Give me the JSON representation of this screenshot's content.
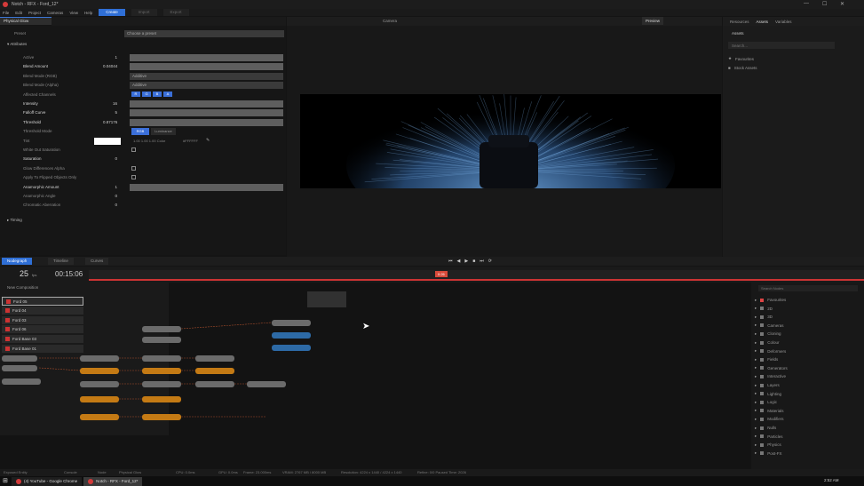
{
  "titlebar": {
    "title": "Notch - RFX - Ford_12*",
    "min": "—",
    "max": "☐",
    "close": "✕"
  },
  "menu": {
    "items": [
      "File",
      "Edit",
      "Project",
      "Cameras",
      "View",
      "Help"
    ],
    "tabs": [
      "Create",
      "Import",
      "Export"
    ]
  },
  "properties": {
    "tab": "Physical Glow",
    "preset_label": "Preset",
    "preset_value": "Choose a preset",
    "section": "Attributes",
    "rows": [
      {
        "label": "Active",
        "value": "1",
        "kind": "bar",
        "bold": false
      },
      {
        "label": "Blend Amount",
        "value": "0.04044",
        "kind": "bar",
        "bold": true
      },
      {
        "label": "Blend Mode (RGB)",
        "value": "Additive",
        "kind": "select",
        "bold": false
      },
      {
        "label": "Blend Mode (Alpha)",
        "value": "Additive",
        "kind": "select",
        "bold": false
      },
      {
        "label": "Affected Channels",
        "value": "",
        "kind": "channels",
        "bold": false
      },
      {
        "label": "Intensity",
        "value": "16",
        "kind": "bar",
        "bold": true
      },
      {
        "label": "Falloff Curve",
        "value": "5",
        "kind": "bar",
        "bold": true
      },
      {
        "label": "Threshold",
        "value": "0.87176",
        "kind": "bar",
        "bold": true
      },
      {
        "label": "Threshold Mode",
        "value": "",
        "kind": "mode",
        "bold": false
      },
      {
        "label": "Tint",
        "value": "",
        "kind": "tint",
        "bold": false
      },
      {
        "label": "White Out Saturation",
        "value": "",
        "kind": "check",
        "bold": false
      },
      {
        "label": "Saturation",
        "value": "0",
        "kind": "none",
        "bold": true
      },
      {
        "label": "Glow Differences Alpha",
        "value": "",
        "kind": "check",
        "bold": false
      },
      {
        "label": "Apply To Flipped Objects Only",
        "value": "",
        "kind": "check",
        "bold": false
      },
      {
        "label": "Anamorphic Amount",
        "value": "1",
        "kind": "bar",
        "bold": true
      },
      {
        "label": "Anamorphic Angle",
        "value": "0",
        "kind": "none",
        "bold": false
      },
      {
        "label": "Chromatic Aberration",
        "value": "0",
        "kind": "none",
        "bold": false
      }
    ],
    "channels": [
      "R",
      "G",
      "B",
      "A"
    ],
    "modes": [
      "RGB",
      "Luminance"
    ],
    "tint": {
      "rgb": "1.00 1.00 1.00 Color",
      "hex": "#FFFFFF"
    },
    "timing_section": "Timing"
  },
  "viewport": {
    "preview_btn": "Preview",
    "view_label": "Camera"
  },
  "right_panel": {
    "tabs": [
      "Resources",
      "Assets",
      "Variables"
    ],
    "title": "Assets",
    "search_placeholder": "Search...",
    "items": [
      "Favourites",
      "Stock Assets"
    ]
  },
  "nodegraph": {
    "tabs": [
      "Nodegraph",
      "Timeline",
      "Curves"
    ],
    "frame": "25",
    "frame_unit": "fps",
    "time": "00:15:06",
    "layer_header": "New Composition",
    "layers": [
      "Ford 05",
      "Ford 04",
      "Ford 03",
      "Ford 06",
      "Ford Base 03",
      "Ford Base 01"
    ],
    "time_marker": "0:26"
  },
  "library": {
    "search_placeholder": "Search Nodes",
    "items": [
      "Favourites",
      "2D",
      "3D",
      "Cameras",
      "Cloning",
      "Colour",
      "Deformers",
      "Fields",
      "Generators",
      "Interactive",
      "Layers",
      "Lighting",
      "Logic",
      "Materials",
      "Modifiers",
      "Nulls",
      "Particles",
      "Physics",
      "Post-FX"
    ]
  },
  "status": {
    "items": [
      "Exposed Entity",
      "Console",
      "Node",
      "Physical Glow",
      "CPU: 0.0ms",
      "GPU: 0.0ms",
      "Frame: 23.000ms",
      "VRAM: 2767 MB / 8000 MB",
      "Resolution: 4224 x 1440 / 4224 x 1440",
      "Refine: 0/0 Paused Time: 2026"
    ]
  },
  "taskbar": {
    "items": [
      "(4) YouTube - Google Chrome",
      "Notch - RFX - Ford_12*"
    ],
    "clock": "2:52 AM"
  },
  "colors": {
    "accent": "#2f6fd6",
    "node_orange": "#c47a14",
    "node_gray": "#6b6b6b",
    "node_blue": "#2d6aa6",
    "record_red": "#d43a3a"
  }
}
